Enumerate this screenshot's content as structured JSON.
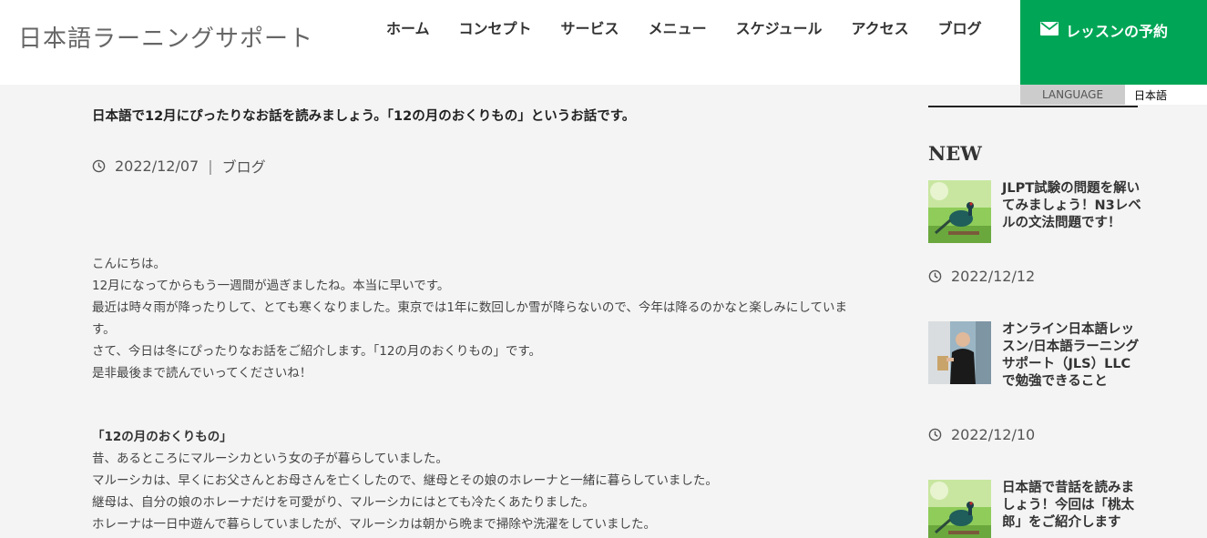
{
  "header": {
    "site_title": "日本語ラーニングサポート",
    "nav": [
      "ホーム",
      "コンセプト",
      "サービス",
      "メニュー",
      "スケジュール",
      "アクセス",
      "ブログ"
    ],
    "reserve_label": "レッスンの予約",
    "reserve_color": "#00a656"
  },
  "language": {
    "label": "LANGUAGE",
    "value": "日本語"
  },
  "article": {
    "title": "日本語で12月にぴったりなお話を読みましょう。「12の月のおくりもの」というお話です。",
    "date": "2022/12/07",
    "category": "ブログ",
    "intro": [
      "こんにちは。",
      "12月になってからもう一週間が過ぎましたね。本当に早いです。",
      "最近は時々雨が降ったりして、とても寒くなりました。東京では1年に数回しか雪が降らないので、今年は降るのかなと楽しみにしていま",
      "す。",
      "さて、今日は冬にぴったりなお話をご紹介します。「12の月のおくりもの」です。",
      "是非最後まで読んでいってくださいね！"
    ],
    "story_heading": "「12の月のおくりもの」",
    "story": [
      "昔、あるところにマルーシカという女の子が暮らしていました。",
      "マルーシカは、早くにお父さんとお母さんを亡くしたので、継母とその娘のホレーナと一緒に暮らしていました。",
      "継母は、自分の娘のホレーナだけを可愛がり、マルーシカにはとても冷たくあたりました。",
      "ホレーナは一日中遊んで暮らしていましたが、マルーシカは朝から晩まで掃除や洗濯をしていました。"
    ]
  },
  "sidebar": {
    "heading": "NEW",
    "posts": [
      {
        "title": "JLPT試験の問題を解いてみましょう！N3レベルの文法問題です！",
        "date": "2022/12/12",
        "thumb": "bird-photo"
      },
      {
        "title": "オンライン日本語レッスン/日本語ラーニングサポート（JLS）LLCで勉強できること",
        "date": "2022/12/10",
        "thumb": "teacher-photo"
      },
      {
        "title": "日本語で昔話を読みましょう！今回は「桃太郎」をご紹介します",
        "date": "",
        "thumb": "bird-photo"
      }
    ]
  }
}
